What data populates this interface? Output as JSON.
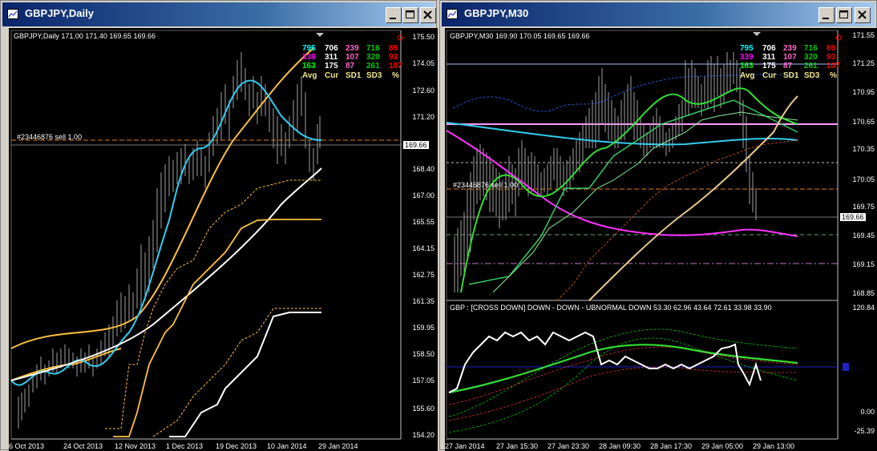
{
  "left_window": {
    "title": "GBPJPY,Daily",
    "header": "GBPJPY,Daily  171.00 171.40 169.65 169.66",
    "order_label": "#23446876 sell 1.00",
    "current_price": "169.66",
    "price_scale": [
      "175.50",
      "174.05",
      "172.60",
      "171.20",
      "169.80",
      "168.40",
      "167.00",
      "165.55",
      "164.15",
      "162.75",
      "161.35",
      "159.95",
      "158.50",
      "157.05",
      "155.60",
      "154.20"
    ],
    "time_scale": [
      "6 Oct 2013",
      "24 Oct 2013",
      "12 Nov 2013",
      "1 Dec 2013",
      "19 Dec 2013",
      "10 Jan 2014",
      "29 Jan 2014"
    ],
    "stats": {
      "row1": [
        "795",
        "706",
        "239",
        "716",
        "89"
      ],
      "row2": [
        "339",
        "311",
        "107",
        "320",
        "93"
      ],
      "row3": [
        "163",
        "175",
        "87",
        "261",
        "107"
      ],
      "headers": [
        "Avg",
        "Cur",
        "SD1",
        "SD3",
        "%"
      ]
    }
  },
  "right_window": {
    "title": "GBPJPY,M30",
    "header": "GBPJPY,M30  169.90 170.05 169.65 169.66",
    "order_label": "#23446876 sell 1.00",
    "current_price": "169.66",
    "price_scale": [
      "171.55",
      "171.25",
      "170.95",
      "170.65",
      "170.35",
      "170.05",
      "169.75",
      "169.45",
      "169.15",
      "168.85"
    ],
    "time_scale": [
      "27 Jan 2014",
      "27 Jan 15:30",
      "27 Jan 23:30",
      "28 Jan 09:30",
      "28 Jan 17:30",
      "29 Jan 05:00",
      "29 Jan 13:00"
    ],
    "stats": {
      "row1": [
        "795",
        "706",
        "239",
        "716",
        "89"
      ],
      "row2": [
        "339",
        "311",
        "107",
        "320",
        "93"
      ],
      "row3": [
        "163",
        "175",
        "87",
        "261",
        "107"
      ],
      "headers": [
        "Avg",
        "Cur",
        "SD1",
        "SD3",
        "%"
      ]
    },
    "indicator": {
      "label": "GBP :  [CROSS DOWN]  DOWN  -  DOWN  -  UBNORMAL DOWN    53.30 62.96 43.64 72.61 33.98 33.90",
      "scale": [
        "120.84",
        "0.00",
        "-25.39"
      ]
    }
  },
  "colors": {
    "stat_cyan": "#00ffff",
    "stat_white": "#ffffff",
    "stat_pink": "#ff66cc",
    "stat_green": "#00cc00",
    "stat_red": "#ff0000",
    "stat_header": "#f0e68c"
  }
}
